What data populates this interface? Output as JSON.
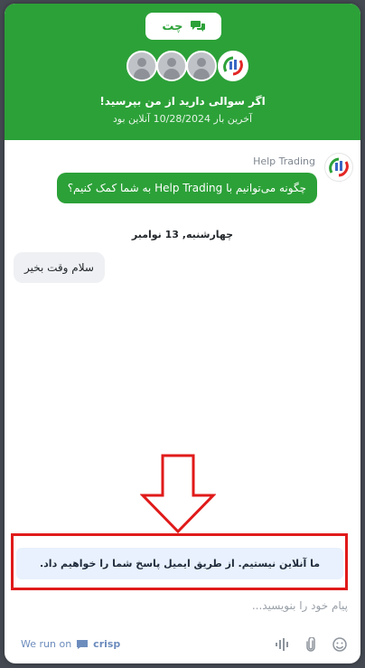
{
  "header": {
    "chat_tab_label": "چت",
    "title": "اگر سوالی دارید از من بپرسید!",
    "subtitle": "آخرین بار 10/28/2024 آنلاین بود",
    "accent_color": "#2ca138"
  },
  "conversation": {
    "operator_name": "Help Trading",
    "operator_message": "چگونه می‌توانیم با Help Trading به شما کمک کنیم؟",
    "date_separator": "چهارشنبه, 13 نوامبر",
    "user_message": "سلام وقت بخیر"
  },
  "offline_notice": "ما آنلاین نیستیم. از طریق ایمیل پاسخ شما را خواهیم داد.",
  "composer": {
    "placeholder": "پیام خود را بنویسید...",
    "value": ""
  },
  "footer": {
    "powered_prefix": "We run on",
    "powered_brand": "crisp",
    "icons": [
      "audio-wave-icon",
      "attachment-icon",
      "emoji-icon"
    ]
  },
  "annotation_color": "#e01a1a"
}
